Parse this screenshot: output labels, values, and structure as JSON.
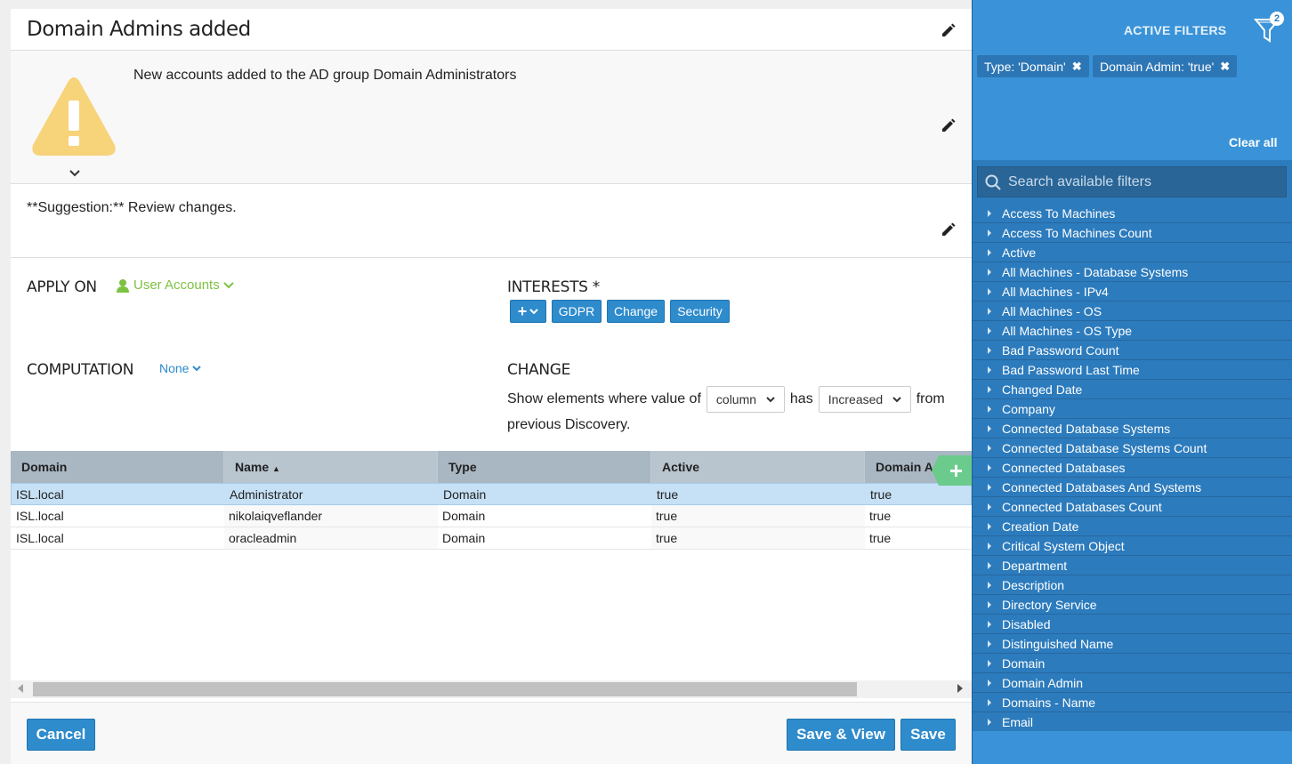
{
  "header": {
    "title": "Domain Admins added"
  },
  "description": {
    "text": "New accounts added to the AD group Domain Administrators"
  },
  "suggestion": {
    "text": "**Suggestion:** Review changes."
  },
  "apply_on": {
    "label": "APPLY ON",
    "value": "User Accounts"
  },
  "interests": {
    "label": "INTERESTS *",
    "tags": [
      "GDPR",
      "Change",
      "Security"
    ]
  },
  "computation": {
    "label": "COMPUTATION",
    "value": "None"
  },
  "change": {
    "label": "CHANGE",
    "prefix": "Show elements where value of",
    "column_select": "column",
    "middle": "has",
    "direction_select": "Increased",
    "suffix": "from",
    "line2": "previous Discovery."
  },
  "grid": {
    "columns": [
      "Domain",
      "Name",
      "Type",
      "Active",
      "Domain A"
    ],
    "sort_indicator": "▲",
    "rows": [
      [
        "ISL.local",
        "Administrator",
        "Domain",
        "true",
        "true"
      ],
      [
        "ISL.local",
        "nikolaiqveflander",
        "Domain",
        "true",
        "true"
      ],
      [
        "ISL.local",
        "oracleadmin",
        "Domain",
        "true",
        "true"
      ]
    ]
  },
  "footer": {
    "cancel": "Cancel",
    "save_view": "Save & View",
    "save": "Save"
  },
  "filters_panel": {
    "title": "ACTIVE FILTERS",
    "count": "2",
    "active": [
      "Type: 'Domain'",
      "Domain Admin: 'true'"
    ],
    "clear_all": "Clear all",
    "search_placeholder": "Search available filters",
    "available": [
      "Access To Machines",
      "Access To Machines Count",
      "Active",
      "All Machines - Database Systems",
      "All Machines - IPv4",
      "All Machines - OS",
      "All Machines - OS Type",
      "Bad Password Count",
      "Bad Password Last Time",
      "Changed Date",
      "Company",
      "Connected Database Systems",
      "Connected Database Systems Count",
      "Connected Databases",
      "Connected Databases And Systems",
      "Connected Databases Count",
      "Creation Date",
      "Critical System Object",
      "Department",
      "Description",
      "Directory Service",
      "Disabled",
      "Distinguished Name",
      "Domain",
      "Domain Admin",
      "Domains - Name",
      "Email"
    ]
  },
  "colors": {
    "primary": "#2e8bcc",
    "green": "#7dc242",
    "warning": "#f7d37a",
    "panel": "#2c7bbd"
  }
}
